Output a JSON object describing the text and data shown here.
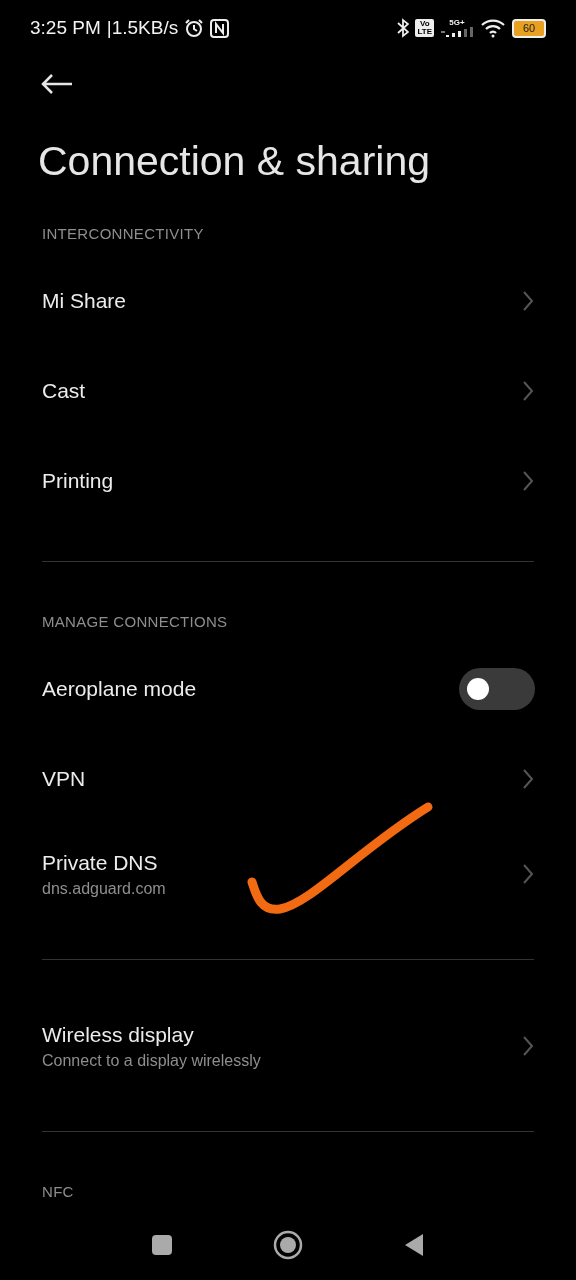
{
  "status_bar": {
    "time": "3:25 PM",
    "speed": "|1.5KB/s",
    "volte_top": "Vo",
    "volte_bottom": "LTE",
    "network": "5G+",
    "battery": "60"
  },
  "title": "Connection & sharing",
  "sections": [
    {
      "header": "INTERCONNECTIVITY",
      "items": [
        {
          "kind": "link",
          "label": "Mi Share"
        },
        {
          "kind": "link",
          "label": "Cast"
        },
        {
          "kind": "link",
          "label": "Printing"
        }
      ]
    },
    {
      "header": "MANAGE CONNECTIONS",
      "items": [
        {
          "kind": "toggle",
          "label": "Aeroplane mode",
          "on": false
        },
        {
          "kind": "link",
          "label": "VPN"
        },
        {
          "kind": "link",
          "label": "Private DNS",
          "summary": "dns.adguard.com"
        }
      ]
    },
    {
      "items": [
        {
          "kind": "link",
          "label": "Wireless display",
          "summary": "Connect to a display wirelessly"
        }
      ]
    },
    {
      "header": "NFC"
    }
  ]
}
